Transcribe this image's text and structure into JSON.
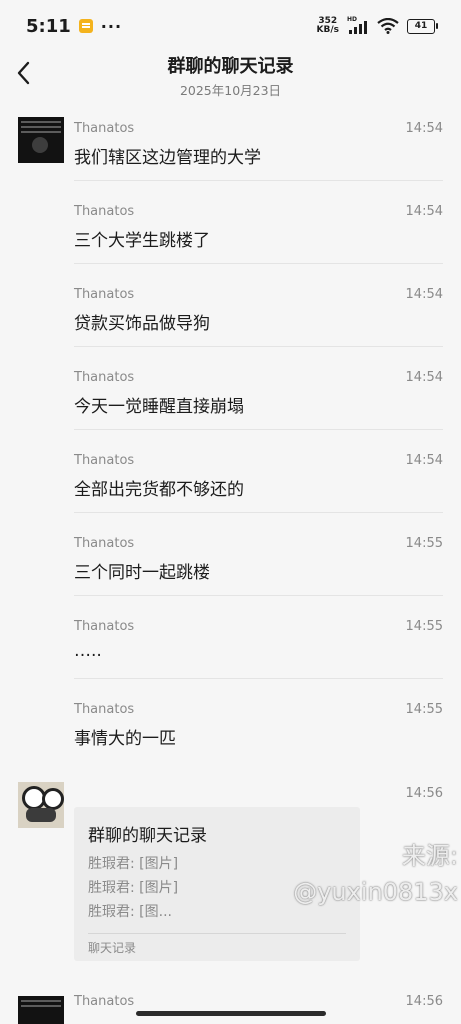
{
  "status_bar": {
    "time": "5:11",
    "dots": "···",
    "speed_value": "352",
    "speed_unit": "KB/s",
    "network_label": "HD",
    "battery": "41"
  },
  "header": {
    "title": "群聊的聊天记录",
    "date": "2025年10月23日"
  },
  "messages": [
    {
      "sender": "Thanatos",
      "time": "14:54",
      "text": "我们辖区这边管理的大学"
    },
    {
      "sender": "Thanatos",
      "time": "14:54",
      "text": "三个大学生跳楼了"
    },
    {
      "sender": "Thanatos",
      "time": "14:54",
      "text": "贷款买饰品做导狗"
    },
    {
      "sender": "Thanatos",
      "time": "14:54",
      "text": "今天一觉睡醒直接崩塌"
    },
    {
      "sender": "Thanatos",
      "time": "14:54",
      "text": "全部出完货都不够还的"
    },
    {
      "sender": "Thanatos",
      "time": "14:55",
      "text": "三个同时一起跳楼"
    },
    {
      "sender": "Thanatos",
      "time": "14:55",
      "text": "….."
    },
    {
      "sender": "Thanatos",
      "time": "14:55",
      "text": "事情大的一匹"
    }
  ],
  "card_message": {
    "time": "14:56",
    "card_title": "群聊的聊天记录",
    "lines": [
      "胜瑕君: [图片]",
      "胜瑕君: [图片]",
      "胜瑕君: [图..."
    ],
    "footer": "聊天记录"
  },
  "watermark": {
    "line1": "来源:",
    "line2": "@yuxin0813x"
  },
  "next_message": {
    "sender": "Thanatos",
    "time": "14:56"
  },
  "icons": [
    "back-icon",
    "notification-icon",
    "signal-icon",
    "wifi-icon",
    "battery-icon"
  ]
}
